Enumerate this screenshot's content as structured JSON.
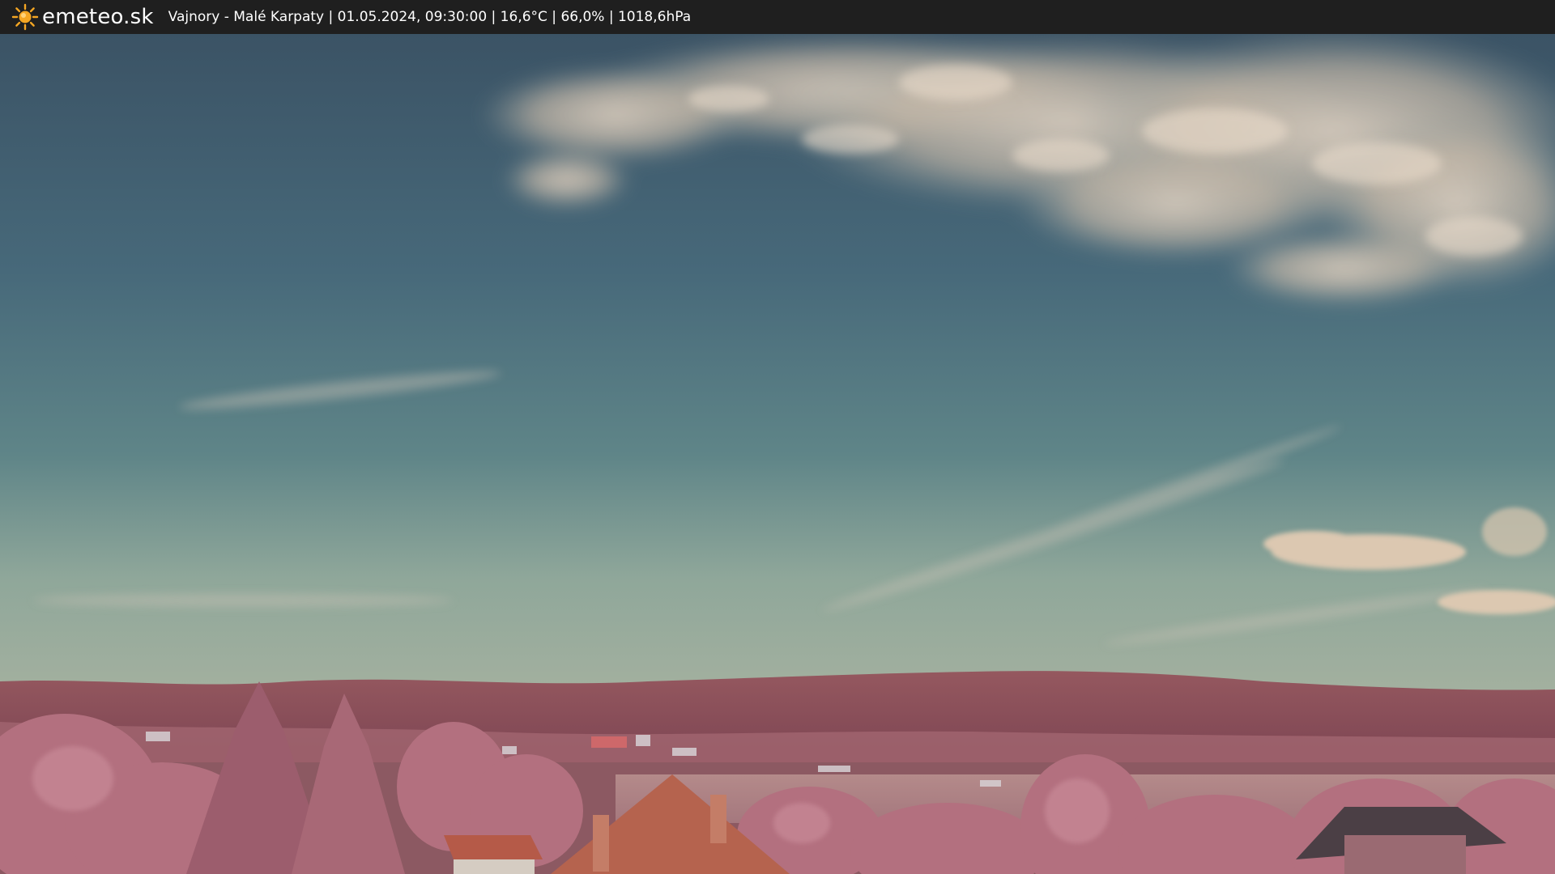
{
  "header": {
    "brand": "emeteo.sk",
    "caption": "Vajnory - Malé Karpaty | 01.05.2024, 09:30:00 | 16,6°C | 66,0% | 1018,6hPa",
    "logo_icon": "sun-icon",
    "background_color": "#1f1f1f",
    "text_color": "#ffffff",
    "sun_color": "#f5a623"
  },
  "scene": {
    "sky_color_top": "#3c5468",
    "sky_color_horizon": "#8fa79a",
    "cloud_color": "#d6c6b4",
    "hill_color": "#8a4e5a",
    "vegetation_color": "#b8788a",
    "roof_color": "#b85a44"
  }
}
